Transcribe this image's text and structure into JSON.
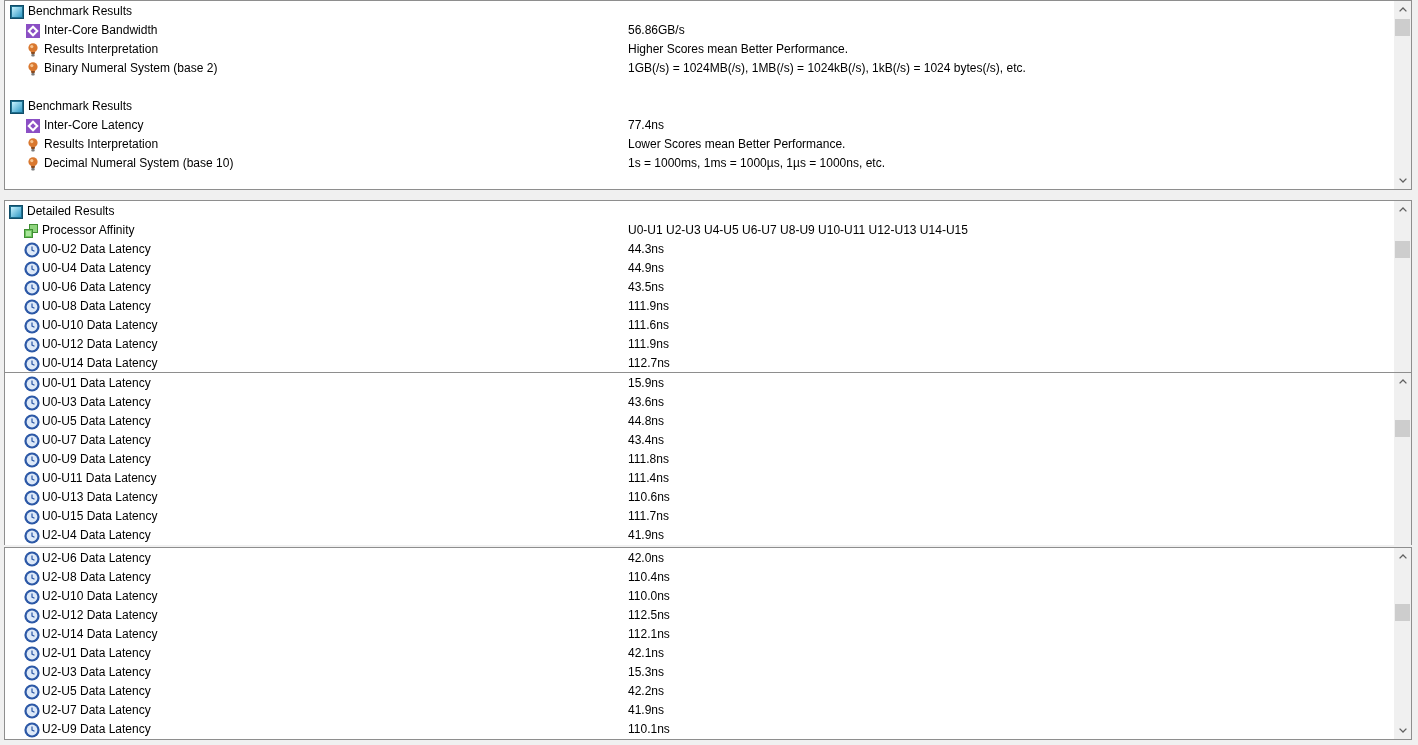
{
  "panels": [
    {
      "clipped_bottom": false,
      "groups": [
        {
          "header": {
            "kind": "group",
            "label": "Benchmark Results"
          },
          "children": [
            {
              "kind": "metric",
              "label": "Inter-Core Bandwidth",
              "value": "56.86GB/s"
            },
            {
              "kind": "info",
              "label": "Results Interpretation",
              "value": "Higher Scores mean Better Performance."
            },
            {
              "kind": "info",
              "label": "Binary Numeral System (base 2)",
              "value": "1GB(/s) = 1024MB(/s), 1MB(/s) = 1024kB(/s), 1kB(/s) = 1024 bytes(/s), etc."
            }
          ]
        },
        {
          "header": {
            "kind": "group",
            "label": "Benchmark Results"
          },
          "children": [
            {
              "kind": "metric",
              "label": "Inter-Core Latency",
              "value": "77.4ns"
            },
            {
              "kind": "info",
              "label": "Results Interpretation",
              "value": "Lower Scores mean Better Performance."
            },
            {
              "kind": "info",
              "label": "Decimal Numeral System (base 10)",
              "value": "1s = 1000ms, 1ms = 1000µs, 1µs = 1000ns, etc."
            }
          ]
        }
      ]
    },
    {
      "clipped_bottom": true,
      "groups": [
        {
          "header": {
            "kind": "group",
            "label": "Detailed Results"
          },
          "children": [
            {
              "kind": "affinity",
              "label": "Processor Affinity",
              "value": "U0-U1 U2-U3 U4-U5 U6-U7 U8-U9 U10-U11 U12-U13 U14-U15"
            },
            {
              "kind": "latency",
              "label": "U0-U2 Data Latency",
              "value": "44.3ns"
            },
            {
              "kind": "latency",
              "label": "U0-U4 Data Latency",
              "value": "44.9ns"
            },
            {
              "kind": "latency",
              "label": "U0-U6 Data Latency",
              "value": "43.5ns"
            },
            {
              "kind": "latency",
              "label": "U0-U8 Data Latency",
              "value": "111.9ns"
            },
            {
              "kind": "latency",
              "label": "U0-U10 Data Latency",
              "value": "111.6ns"
            },
            {
              "kind": "latency",
              "label": "U0-U12 Data Latency",
              "value": "111.9ns"
            },
            {
              "kind": "latency",
              "label": "U0-U14 Data Latency",
              "value": "112.7ns"
            }
          ]
        }
      ]
    },
    {
      "clipped_bottom": true,
      "groups": [
        {
          "children": [
            {
              "kind": "latency",
              "label": "U0-U1 Data Latency",
              "value": "15.9ns"
            },
            {
              "kind": "latency",
              "label": "U0-U3 Data Latency",
              "value": "43.6ns"
            },
            {
              "kind": "latency",
              "label": "U0-U5 Data Latency",
              "value": "44.8ns"
            },
            {
              "kind": "latency",
              "label": "U0-U7 Data Latency",
              "value": "43.4ns"
            },
            {
              "kind": "latency",
              "label": "U0-U9 Data Latency",
              "value": "111.8ns"
            },
            {
              "kind": "latency",
              "label": "U0-U11 Data Latency",
              "value": "111.4ns"
            },
            {
              "kind": "latency",
              "label": "U0-U13 Data Latency",
              "value": "110.6ns"
            },
            {
              "kind": "latency",
              "label": "U0-U15 Data Latency",
              "value": "111.7ns"
            },
            {
              "kind": "latency",
              "label": "U2-U4 Data Latency",
              "value": "41.9ns"
            }
          ]
        }
      ]
    },
    {
      "clipped_bottom": false,
      "groups": [
        {
          "children": [
            {
              "kind": "latency",
              "label": "U2-U6 Data Latency",
              "value": "42.0ns"
            },
            {
              "kind": "latency",
              "label": "U2-U8 Data Latency",
              "value": "110.4ns"
            },
            {
              "kind": "latency",
              "label": "U2-U10 Data Latency",
              "value": "110.0ns"
            },
            {
              "kind": "latency",
              "label": "U2-U12 Data Latency",
              "value": "112.5ns"
            },
            {
              "kind": "latency",
              "label": "U2-U14 Data Latency",
              "value": "112.1ns"
            },
            {
              "kind": "latency",
              "label": "U2-U1 Data Latency",
              "value": "42.1ns"
            },
            {
              "kind": "latency",
              "label": "U2-U3 Data Latency",
              "value": "15.3ns"
            },
            {
              "kind": "latency",
              "label": "U2-U5 Data Latency",
              "value": "42.2ns"
            },
            {
              "kind": "latency",
              "label": "U2-U7 Data Latency",
              "value": "41.9ns"
            },
            {
              "kind": "latency",
              "label": "U2-U9 Data Latency",
              "value": "110.1ns"
            }
          ]
        }
      ]
    }
  ]
}
